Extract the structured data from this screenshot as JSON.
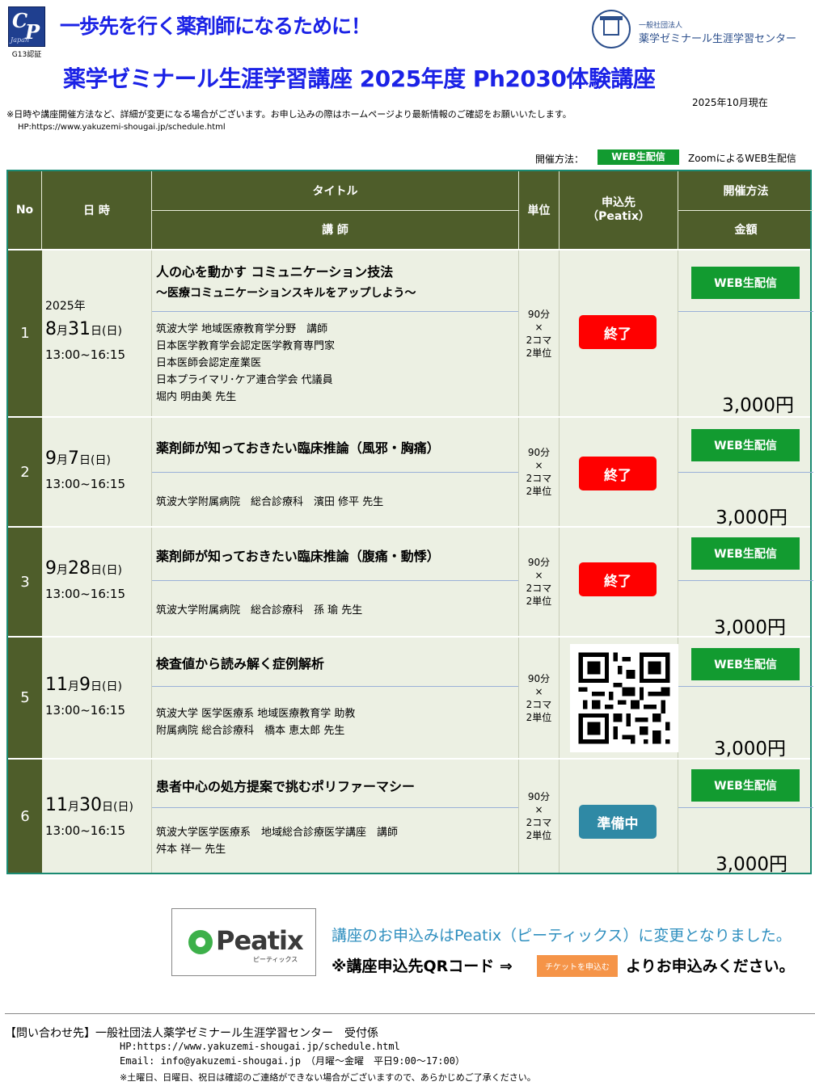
{
  "header": {
    "cpc_logo_letters": "CPC",
    "cpc_logo_sub": "Japan",
    "cert": "G13認証",
    "tagline": "一歩先を行く薬剤師になるために！",
    "org_sub": "一般社団法人",
    "org_name": "薬学ゼミナール生涯学習センター",
    "title": "薬学ゼミナール生涯学習講座 2025年度 Ph2030体験講座",
    "as_of": "2025年10月現在",
    "notice": "※日時や講座開催方法など、詳細が変更になる場合がございます。お申し込みの際はホームページより最新情報のご確認をお願いいたします。",
    "hp": "HP:https://www.yakuzemi-shougai.jp/schedule.html"
  },
  "legend": {
    "label": "開催方法：",
    "badge": "WEB生配信",
    "desc": "ZoomによるWEB生配信"
  },
  "table_headers": {
    "no": "No",
    "date": "日 時",
    "title": "タイトル",
    "lecturer": "講 師",
    "unit": "単位",
    "apply": "申込先\n（Peatix）",
    "method": "開催方法",
    "price": "金額"
  },
  "rows": [
    {
      "no": "1",
      "year": "2025年",
      "month": "8",
      "m_char": "月",
      "day": "31",
      "d_char": "日(日)",
      "time": "13:00~16:15",
      "title": "人の心を動かす コミュニケーション技法",
      "subtitle": "～医療コミュニケーションスキルをアップしよう～",
      "lecturer_lines": [
        "筑波大学 地域医療教育学分野　講師",
        "日本医学教育学会認定医学教育専門家",
        "日本医師会認定産業医",
        "日本プライマリ･ケア連合学会 代議員",
        "堀内 明由美 先生"
      ],
      "unit": [
        "90分",
        "×",
        "2コマ",
        "2単位"
      ],
      "status": "終了",
      "method": "WEB生配信",
      "price": "3,000円"
    },
    {
      "no": "2",
      "month": "9",
      "m_char": "月",
      "day": "7",
      "d_char": "日(日)",
      "time": "13:00~16:15",
      "title": "薬剤師が知っておきたい臨床推論（風邪・胸痛）",
      "lecturer_lines": [
        "筑波大学附属病院　総合診療科　濱田 修平 先生"
      ],
      "unit": [
        "90分",
        "×",
        "2コマ",
        "2単位"
      ],
      "status": "終了",
      "method": "WEB生配信",
      "price": "3,000円"
    },
    {
      "no": "3",
      "month": "9",
      "m_char": "月",
      "day": "28",
      "d_char": "日(日)",
      "time": "13:00~16:15",
      "title": "薬剤師が知っておきたい臨床推論（腹痛・動悸）",
      "lecturer_lines": [
        "筑波大学附属病院　総合診療科　孫 瑜 先生"
      ],
      "unit": [
        "90分",
        "×",
        "2コマ",
        "2単位"
      ],
      "status": "終了",
      "method": "WEB生配信",
      "price": "3,000円"
    },
    {
      "no": "5",
      "month": "11",
      "m_char": "月",
      "day": "9",
      "d_char": "日(日)",
      "time": "13:00~16:15",
      "title": "検査値から読み解く症例解析",
      "lecturer_lines": [
        "筑波大学 医学医療系 地域医療教育学 助教",
        "附属病院 総合診療科　橋本 恵太郎 先生"
      ],
      "unit": [
        "90分",
        "×",
        "2コマ",
        "2単位"
      ],
      "status": "",
      "method": "WEB生配信",
      "price": "3,000円"
    },
    {
      "no": "6",
      "month": "11",
      "m_char": "月",
      "day": "30",
      "d_char": "日(日)",
      "time": "13:00~16:15",
      "title": "患者中心の処方提案で挑むポリファーマシー",
      "lecturer_lines": [
        "筑波大学医学医療系　地域総合診療医学講座　講師",
        "舛本 祥一 先生"
      ],
      "unit": [
        "90分",
        "×",
        "2コマ",
        "2単位"
      ],
      "status": "準備中",
      "method": "WEB生配信",
      "price": "3,000円"
    }
  ],
  "peatix": {
    "brand": "Peatix",
    "brand_kana": "ピーティックス",
    "info1": "講座のお申込みはPeatix（ピーティックス）に変更となりました。",
    "info2": "※講座申込先QRコード ⇒",
    "ticket_button": "チケットを申込む",
    "info3": "よりお申込みください。"
  },
  "footer": {
    "contact": "【問い合わせ先】一般社団法人薬学ゼミナール生涯学習センター　受付係",
    "hp": "HP:https://www.yakuzemi-shougai.jp/schedule.html",
    "email": "Email: info@yakuzemi-shougai.jp　（月曜～金曜　平日9:00～17:00）",
    "note": "※土曜日、日曜日、祝日は確認のご連絡ができない場合がございますので、あらかじめご了承ください。"
  },
  "colors": {
    "header_green": "#4e5d2a",
    "row_bg": "#ecf0e3",
    "web_green": "#129b30",
    "end_red": "#ff0000",
    "prep_teal": "#2f89a5",
    "title_blue": "#1b22e6"
  }
}
